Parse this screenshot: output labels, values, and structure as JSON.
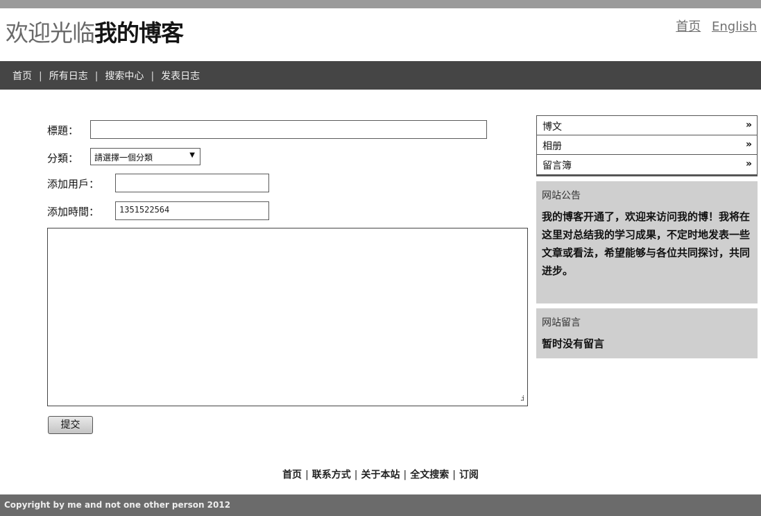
{
  "header": {
    "title_welcome": "欢迎光临",
    "title_blog": "我的博客",
    "link_home": "首页",
    "link_english": "English"
  },
  "nav": {
    "items": [
      "首页",
      "所有日志",
      "搜索中心",
      "发表日志"
    ],
    "separator": "|"
  },
  "form": {
    "title_label": "標題：",
    "title_value": "",
    "category_label": "分類：",
    "category_selected": "請選擇一個分類",
    "user_label": "添加用戶：",
    "user_value": "",
    "time_label": "添加時間：",
    "time_value": "1351522564",
    "content_value": "",
    "submit_label": "提交"
  },
  "sidebar": {
    "menu": [
      "博文",
      "相册",
      "留言簿"
    ],
    "chevron": "»",
    "notice_title": "网站公告",
    "notice_body": "我的博客开通了，欢迎来访问我的博！我将在这里对总结我的学习成果，不定时地发表一些文章或看法，希望能够与各位共同探讨，共同进步。",
    "message_title": "网站留言",
    "message_body": "暂时没有留言"
  },
  "footer": {
    "links": [
      "首页",
      "联系方式",
      "关于本站",
      "全文搜索",
      "订阅"
    ],
    "separator": "|",
    "copyright": "Copyright by me and not one other person 2012"
  }
}
